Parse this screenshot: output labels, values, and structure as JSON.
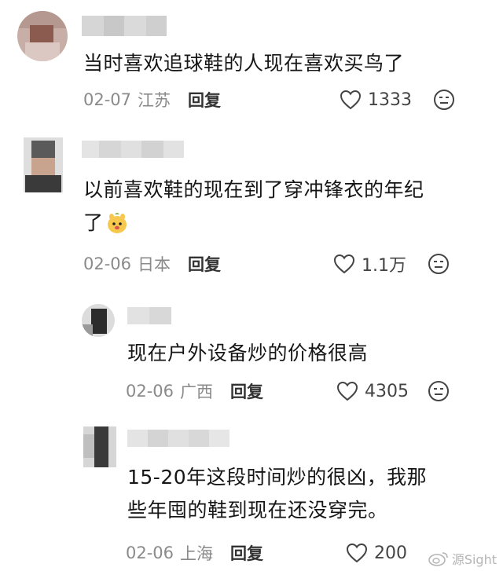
{
  "comments": [
    {
      "text_lines": [
        "当时喜欢追球鞋的人现在喜欢买鸟了"
      ],
      "date": "02-07",
      "location": "江苏",
      "reply_label": "回复",
      "likes": "1333"
    },
    {
      "text_lines": [
        "以前喜欢鞋的现在到了穿冲锋衣的年纪",
        "了"
      ],
      "date": "02-06",
      "location": "日本",
      "reply_label": "回复",
      "likes": "1.1万"
    },
    {
      "text_lines": [
        "现在户外设备炒的价格很高"
      ],
      "date": "02-06",
      "location": "广西",
      "reply_label": "回复",
      "likes": "4305"
    },
    {
      "text_lines": [
        "15-20年这段时间炒的很凶，我那",
        "些年囤的鞋到现在还没穿完。"
      ],
      "date": "02-06",
      "location": "上海",
      "reply_label": "回复",
      "likes": "200"
    }
  ],
  "watermark": "源Sight",
  "icons": {
    "like": "heart-outline-icon",
    "dislike": "dislike-face-icon",
    "emoji": "cute-animal-emoji-icon",
    "watermark_logo": "weibo-logo-icon"
  },
  "colors": {
    "text": "#161616",
    "meta": "#8a8a8a",
    "icon": "#444444"
  }
}
